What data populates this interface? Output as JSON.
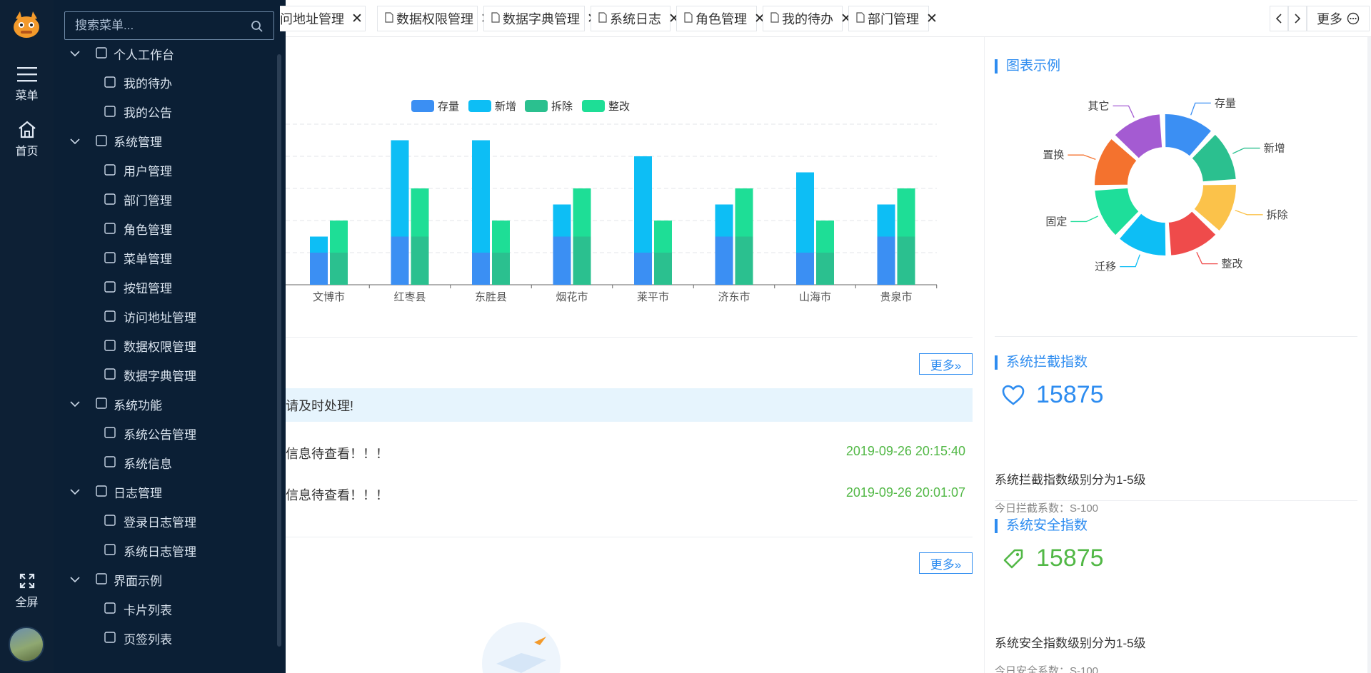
{
  "rail": {
    "menu_label": "菜单",
    "home_label": "首页",
    "fullscreen_label": "全屏"
  },
  "sidebar": {
    "search_placeholder": "搜索菜单...",
    "items": [
      {
        "label": "个人工作台",
        "level": 0,
        "icon": "monitor-icon"
      },
      {
        "label": "我的待办",
        "level": 1,
        "icon": "tag-icon"
      },
      {
        "label": "我的公告",
        "level": 1,
        "icon": "megaphone-icon"
      },
      {
        "label": "系统管理",
        "level": 0,
        "icon": "settings-screen-icon"
      },
      {
        "label": "用户管理",
        "level": 1,
        "icon": "user-icon"
      },
      {
        "label": "部门管理",
        "level": 1,
        "icon": "org-icon"
      },
      {
        "label": "角色管理",
        "level": 1,
        "icon": "users-icon"
      },
      {
        "label": "菜单管理",
        "level": 1,
        "icon": "list-icon"
      },
      {
        "label": "按钮管理",
        "level": 1,
        "icon": "square-icon"
      },
      {
        "label": "访问地址管理",
        "level": 1,
        "icon": "link-icon"
      },
      {
        "label": "数据权限管理",
        "level": 1,
        "icon": "shield-icon"
      },
      {
        "label": "数据字典管理",
        "level": 1,
        "icon": "book-icon"
      },
      {
        "label": "系统功能",
        "level": 0,
        "icon": "grid-icon"
      },
      {
        "label": "系统公告管理",
        "level": 1,
        "icon": "megaphone-icon"
      },
      {
        "label": "系统信息",
        "level": 1,
        "icon": "gauge-icon"
      },
      {
        "label": "日志管理",
        "level": 0,
        "icon": "log-icon"
      },
      {
        "label": "登录日志管理",
        "level": 1,
        "icon": "calendar-icon"
      },
      {
        "label": "系统日志管理",
        "level": 1,
        "icon": "calendar-icon"
      },
      {
        "label": "界面示例",
        "level": 0,
        "icon": "image-icon"
      },
      {
        "label": "卡片列表",
        "level": 1,
        "icon": "image-icon"
      },
      {
        "label": "页签列表",
        "level": 1,
        "icon": "image-icon"
      }
    ]
  },
  "tabs": [
    {
      "label": "问地址管理"
    },
    {
      "label": "数据权限管理"
    },
    {
      "label": "数据字典管理"
    },
    {
      "label": "系统日志"
    },
    {
      "label": "角色管理"
    },
    {
      "label": "我的待办"
    },
    {
      "label": "部门管理"
    }
  ],
  "tab_more_label": "更多",
  "chart_data": [
    {
      "type": "bar",
      "stacked": true,
      "legend_position": "top",
      "categories": [
        "文博市",
        "红枣县",
        "东胜县",
        "烟花市",
        "莱平市",
        "济东市",
        "山海市",
        "贵泉市"
      ],
      "series": [
        {
          "name": "存量",
          "stack": "A",
          "color": "#3b8ff3",
          "values": [
            20,
            30,
            20,
            30,
            20,
            30,
            20,
            30
          ]
        },
        {
          "name": "新增",
          "stack": "A",
          "color": "#0dbef5",
          "values": [
            10,
            60,
            70,
            20,
            60,
            20,
            50,
            20
          ]
        },
        {
          "name": "拆除",
          "stack": "B",
          "color": "#2bc08f",
          "values": [
            20,
            30,
            20,
            30,
            20,
            30,
            20,
            30
          ]
        },
        {
          "name": "整改",
          "stack": "B",
          "color": "#1ede96",
          "values": [
            20,
            30,
            20,
            30,
            20,
            30,
            20,
            30
          ]
        }
      ],
      "ylim": [
        0,
        100
      ],
      "grid": true
    },
    {
      "type": "pie",
      "title": "图表示例",
      "donut": true,
      "slices": [
        {
          "name": "存量",
          "value": 1,
          "color": "#3b8ff3"
        },
        {
          "name": "新增",
          "value": 1,
          "color": "#2bc08f"
        },
        {
          "name": "拆除",
          "value": 1,
          "color": "#fbc24a"
        },
        {
          "name": "整改",
          "value": 1,
          "color": "#ef4b4b"
        },
        {
          "name": "迁移",
          "value": 1,
          "color": "#0dbef5"
        },
        {
          "name": "固定",
          "value": 1,
          "color": "#1ede9a"
        },
        {
          "name": "置换",
          "value": 1,
          "color": "#f4722e"
        },
        {
          "name": "其它",
          "value": 1,
          "color": "#a45bd2"
        }
      ]
    }
  ],
  "todo": {
    "more_label": "更多»",
    "banner": "请及时处理!",
    "rows": [
      {
        "text": "信息待查看！！！",
        "time": "2019-09-26 20:15:40"
      },
      {
        "text": "信息待查看！！！",
        "time": "2019-09-26 20:01:07"
      }
    ]
  },
  "notice": {
    "more_label": "更多»"
  },
  "intercept": {
    "title": "系统拦截指数",
    "value": "15875",
    "desc": "系统拦截指数级别分为1-5级",
    "sub": "今日拦截系数：S-100"
  },
  "safety": {
    "title": "系统安全指数",
    "value": "15875",
    "desc": "系统安全指数级别分为1-5级",
    "sub": "今日安全系数：S-100"
  },
  "colors": {
    "accent": "#2d8cf0",
    "sidebar_bg": "#0b1f35",
    "rail_bg": "#0d2035",
    "success": "#52b846"
  }
}
